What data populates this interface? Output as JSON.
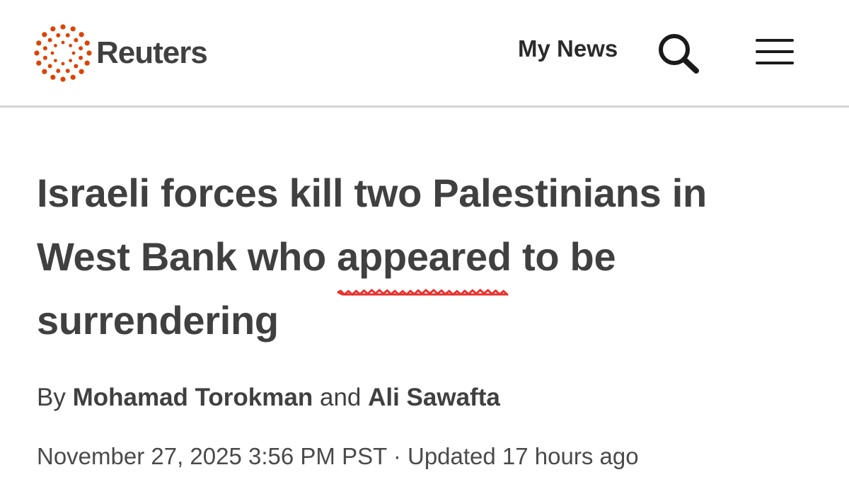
{
  "header": {
    "brand": "Reuters",
    "brand_color": "#dc4300",
    "my_news_label": "My News",
    "search_icon": "search-icon",
    "menu_icon": "hamburger-menu-icon"
  },
  "article": {
    "headline": {
      "line1": "Israeli forces kill two Palestinians in",
      "line2_before": "West Bank who ",
      "line2_highlight": "appeared",
      "line2_after": " to be",
      "line3": "surrendering"
    },
    "highlight_underline_color": "#e8322e",
    "byline": {
      "prefix": "By ",
      "author1": "Mohamad Torokman",
      "conjunction": " and ",
      "author2": "Ali Sawafta"
    },
    "dateline": {
      "published": "November 27, 2025 3:56 PM PST",
      "separator": " · ",
      "updated": "Updated 17 hours ago"
    }
  }
}
